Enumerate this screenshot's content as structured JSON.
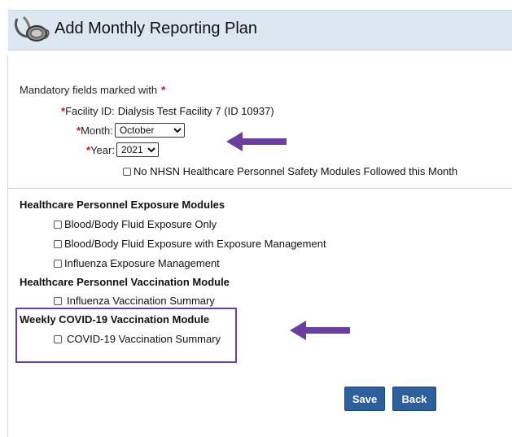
{
  "header": {
    "title": "Add Monthly Reporting Plan",
    "icon": "stethoscope-icon"
  },
  "form": {
    "mandatory_note": "Mandatory fields marked with",
    "required_mark": "*",
    "facility_label": "Facility ID:",
    "facility_value": "Dialysis Test Facility 7 (ID 10937)",
    "month_label": "Month:",
    "month_value": "October",
    "year_label": "Year:",
    "year_value": "2021",
    "no_nhsn_label": "No NHSN Healthcare Personnel Safety Modules Followed this Month"
  },
  "exposure": {
    "heading": "Healthcare Personnel Exposure Modules",
    "items": [
      "Blood/Body Fluid Exposure Only",
      "Blood/Body Fluid Exposure with Exposure Management",
      "Influenza Exposure Management"
    ]
  },
  "vaccination": {
    "heading": "Healthcare Personnel Vaccination Module",
    "items": [
      "Influenza Vaccination Summary"
    ]
  },
  "covid": {
    "heading": "Weekly COVID-19 Vaccination Module",
    "items": [
      "COVID-19 Vaccination Summary"
    ]
  },
  "buttons": {
    "save": "Save",
    "back": "Back"
  },
  "colors": {
    "header_bg": "#dde7f1",
    "button": "#2d5f9c",
    "annotation_purple": "#6b3fa0",
    "required": "#d01010"
  }
}
